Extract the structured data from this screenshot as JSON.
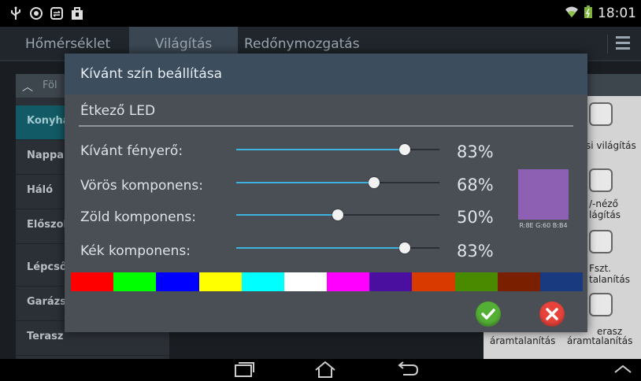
{
  "status_bar": {
    "time": "18:01",
    "left_icons": [
      "usb-icon",
      "eye-icon",
      "sync-icon",
      "bag-icon"
    ],
    "right_icons": [
      "wifi-icon",
      "battery-icon"
    ]
  },
  "tabs": [
    {
      "label": "Hőmérséklet",
      "active": false
    },
    {
      "label": "Világítás",
      "active": true
    },
    {
      "label": "Redőnymozgatás",
      "active": false
    }
  ],
  "rooms_header": "Föl",
  "rooms": [
    {
      "label": "Konyha",
      "active": true
    },
    {
      "label": "Nappal",
      "active": false
    },
    {
      "label": "Háló",
      "active": false
    },
    {
      "label": "Előszob",
      "active": false
    },
    {
      "label": "Lépcső",
      "active": false
    },
    {
      "label": "Garázs",
      "active": false
    },
    {
      "label": "Terasz",
      "active": false
    }
  ],
  "scenes": {
    "s1": "si világítás",
    "s2a": "/-néző",
    "s2b": "lágítás",
    "s3a": "Fszt.",
    "s3b": "talanítás",
    "s4a": "erasz",
    "bottom_left": "áramtalanítás",
    "bottom_right": "áramtalanítás"
  },
  "dialog": {
    "title": "Kívánt szín beállítása",
    "subtitle": "Étkező LED",
    "rows": [
      {
        "label": "Kívánt fényerő:",
        "value_text": "83%",
        "value": 0.83
      },
      {
        "label": "Vörös komponens:",
        "value_text": "68%",
        "value": 0.68
      },
      {
        "label": "Zöld komponens:",
        "value_text": "50%",
        "value": 0.5
      },
      {
        "label": "Kék komponens:",
        "value_text": "83%",
        "value": 0.83
      }
    ],
    "swatch_color": "#8E60B4",
    "swatch_caption": "R:8E G:60 B:B4",
    "palette": [
      "#ff0000",
      "#00ff00",
      "#0000ff",
      "#ffff00",
      "#00ffff",
      "#ffffff",
      "#ff00ff",
      "#4b0fa0",
      "#d83a00",
      "#4a8a00",
      "#7a2000",
      "#1a3a80"
    ],
    "ok_icon": "check-icon",
    "cancel_icon": "close-icon"
  },
  "colors": {
    "accent": "#3fb2df",
    "room_active": "#125a66"
  }
}
